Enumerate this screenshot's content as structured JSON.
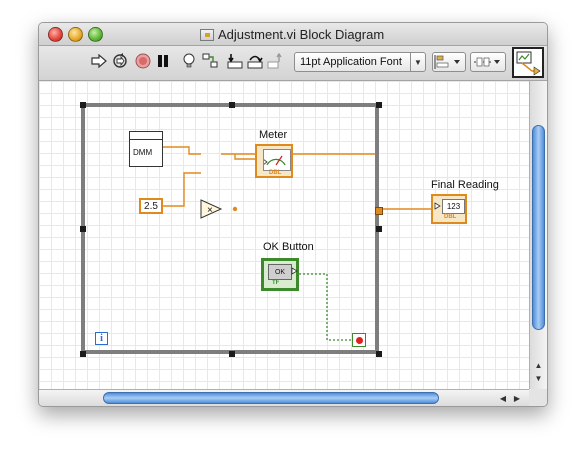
{
  "window": {
    "title": "Adjustment.vi Block Diagram",
    "title_icon": "vi-file-icon"
  },
  "toolbar": {
    "buttons": [
      "run-arrow-icon",
      "run-continuously-icon",
      "abort-icon",
      "pause-icon",
      "highlight-execution-icon",
      "retain-wire-values-icon",
      "step-into-icon",
      "step-over-icon",
      "step-out-icon"
    ],
    "font_select": "11pt Application Font"
  },
  "diagram": {
    "meter_label": "Meter",
    "final_reading_label": "Final Reading",
    "ok_button_label": "OK Button",
    "dmm_text": "DMM",
    "constant_value": "2.5",
    "multiply_symbol": "×",
    "numeric_indicator_text": "123",
    "dbl_tag": "DBL",
    "ok_text": "OK",
    "tf_tag": "TF",
    "info_symbol": "i"
  },
  "colors": {
    "numeric_wire": "#e08a1e",
    "boolean_wire": "#3c8a2c",
    "loop_border": "#7e7e7e",
    "stop_terminal": "#e02020"
  }
}
